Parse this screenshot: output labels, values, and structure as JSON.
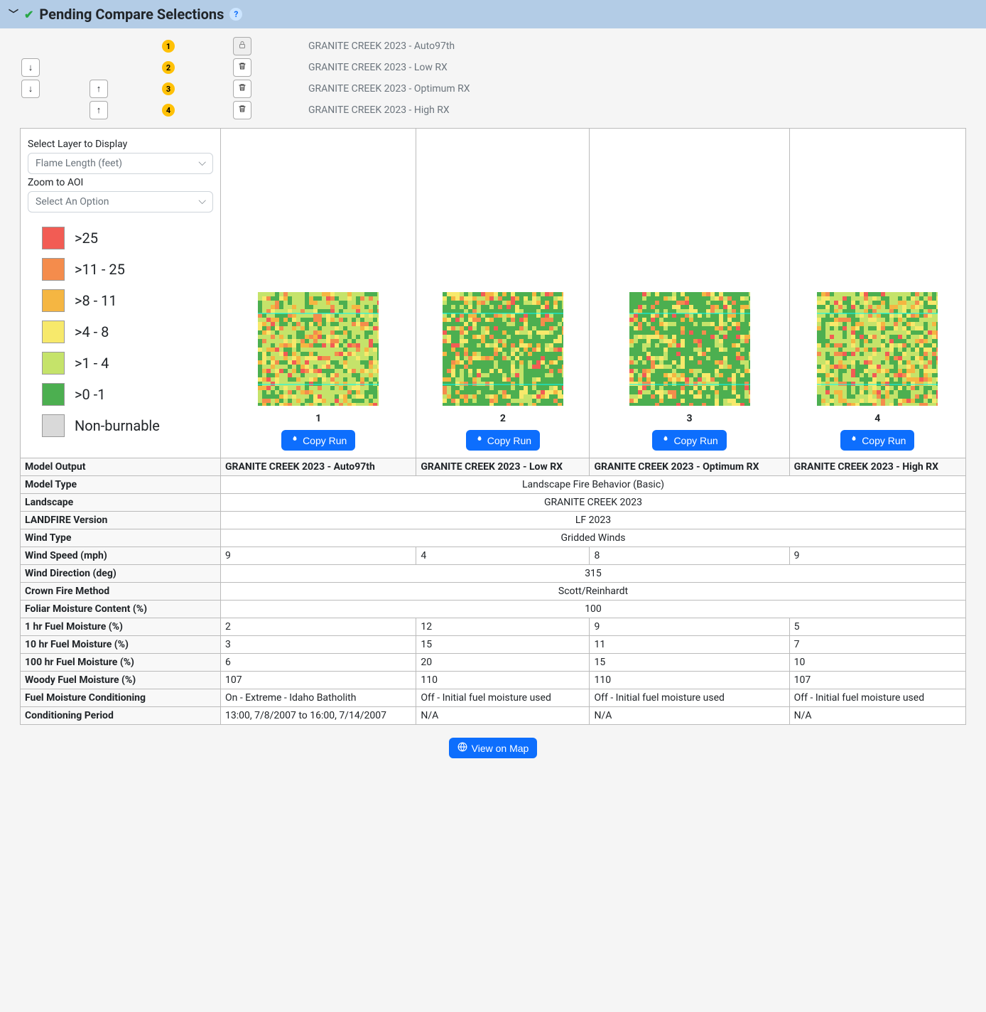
{
  "header": {
    "title": "Pending Compare Selections"
  },
  "pending": [
    {
      "badge": "1",
      "label": "GRANITE CREEK 2023 - Auto97th",
      "can_down": false,
      "can_up": false,
      "can_delete": false,
      "locked": true
    },
    {
      "badge": "2",
      "label": "GRANITE CREEK 2023 - Low RX",
      "can_down": true,
      "can_up": false,
      "can_delete": true,
      "locked": false
    },
    {
      "badge": "3",
      "label": "GRANITE CREEK 2023 - Optimum RX",
      "can_down": true,
      "can_up": true,
      "can_delete": true,
      "locked": false
    },
    {
      "badge": "4",
      "label": "GRANITE CREEK 2023 - High RX",
      "can_down": false,
      "can_up": true,
      "can_delete": true,
      "locked": false
    }
  ],
  "controls": {
    "layer_label": "Select Layer to Display",
    "layer_value": "Flame Length (feet)",
    "zoom_label": "Zoom to AOI",
    "zoom_value": "Select An Option"
  },
  "legend": [
    {
      "color": "#f25c54",
      "label": ">25"
    },
    {
      "color": "#f48c4c",
      "label": ">11 - 25"
    },
    {
      "color": "#f5b642",
      "label": ">8 - 11"
    },
    {
      "color": "#f7e96b",
      "label": ">4 - 8"
    },
    {
      "color": "#c5e36a",
      "label": ">1 - 4"
    },
    {
      "color": "#4caf50",
      "label": ">0 -1"
    },
    {
      "color": "#d9d9d9",
      "label": "Non-burnable"
    }
  ],
  "columns": [
    {
      "num": "1",
      "title": "GRANITE CREEK 2023 - Auto97th",
      "seed": 11
    },
    {
      "num": "2",
      "title": "GRANITE CREEK 2023 - Low RX",
      "seed": 22
    },
    {
      "num": "3",
      "title": "GRANITE CREEK 2023 - Optimum RX",
      "seed": 33
    },
    {
      "num": "4",
      "title": "GRANITE CREEK 2023 - High RX",
      "seed": 44
    }
  ],
  "copy_run_label": "Copy Run",
  "view_on_map_label": "View on Map",
  "rows": [
    {
      "label": "Model Output",
      "type": "header_titles"
    },
    {
      "label": "Model Type",
      "span": "Landscape Fire Behavior (Basic)"
    },
    {
      "label": "Landscape",
      "span": "GRANITE CREEK 2023"
    },
    {
      "label": "LANDFIRE Version",
      "span": "LF 2023"
    },
    {
      "label": "Wind Type",
      "span": "Gridded Winds"
    },
    {
      "label": "Wind Speed (mph)",
      "cells": [
        "9",
        "4",
        "8",
        "9"
      ]
    },
    {
      "label": "Wind Direction (deg)",
      "span": "315"
    },
    {
      "label": "Crown Fire Method",
      "span": "Scott/Reinhardt"
    },
    {
      "label": "Foliar Moisture Content (%)",
      "span": "100"
    },
    {
      "label": "1 hr Fuel Moisture (%)",
      "cells": [
        "2",
        "12",
        "9",
        "5"
      ]
    },
    {
      "label": "10 hr Fuel Moisture (%)",
      "cells": [
        "3",
        "15",
        "11",
        "7"
      ]
    },
    {
      "label": "100 hr Fuel Moisture (%)",
      "cells": [
        "6",
        "20",
        "15",
        "10"
      ]
    },
    {
      "label": "Woody Fuel Moisture (%)",
      "cells": [
        "107",
        "110",
        "110",
        "107"
      ]
    },
    {
      "label": "Fuel Moisture Conditioning",
      "cells": [
        "On - Extreme - Idaho Batholith",
        "Off - Initial fuel moisture used",
        "Off - Initial fuel moisture used",
        "Off - Initial fuel moisture used"
      ]
    },
    {
      "label": "Conditioning Period",
      "cells": [
        "13:00, 7/8/2007 to 16:00, 7/14/2007",
        "N/A",
        "N/A",
        "N/A"
      ]
    }
  ],
  "chart_data": {
    "type": "table",
    "title": "Comparison of model run inputs across four GRANITE CREEK 2023 scenarios, with Flame Length (feet) map thumbnails",
    "columns": [
      "Auto97th",
      "Low RX",
      "Optimum RX",
      "High RX"
    ],
    "legend_classes": [
      ">25",
      ">11 - 25",
      ">8 - 11",
      ">4 - 8",
      ">1 - 4",
      ">0 -1",
      "Non-burnable"
    ],
    "parameters": {
      "Model Type": [
        "Landscape Fire Behavior (Basic)",
        "Landscape Fire Behavior (Basic)",
        "Landscape Fire Behavior (Basic)",
        "Landscape Fire Behavior (Basic)"
      ],
      "Landscape": [
        "GRANITE CREEK 2023",
        "GRANITE CREEK 2023",
        "GRANITE CREEK 2023",
        "GRANITE CREEK 2023"
      ],
      "LANDFIRE Version": [
        "LF 2023",
        "LF 2023",
        "LF 2023",
        "LF 2023"
      ],
      "Wind Type": [
        "Gridded Winds",
        "Gridded Winds",
        "Gridded Winds",
        "Gridded Winds"
      ],
      "Wind Speed (mph)": [
        9,
        4,
        8,
        9
      ],
      "Wind Direction (deg)": [
        315,
        315,
        315,
        315
      ],
      "Crown Fire Method": [
        "Scott/Reinhardt",
        "Scott/Reinhardt",
        "Scott/Reinhardt",
        "Scott/Reinhardt"
      ],
      "Foliar Moisture Content (%)": [
        100,
        100,
        100,
        100
      ],
      "1 hr Fuel Moisture (%)": [
        2,
        12,
        9,
        5
      ],
      "10 hr Fuel Moisture (%)": [
        3,
        15,
        11,
        7
      ],
      "100 hr Fuel Moisture (%)": [
        6,
        20,
        15,
        10
      ],
      "Woody Fuel Moisture (%)": [
        107,
        110,
        110,
        107
      ],
      "Fuel Moisture Conditioning": [
        "On - Extreme - Idaho Batholith",
        "Off - Initial fuel moisture used",
        "Off - Initial fuel moisture used",
        "Off - Initial fuel moisture used"
      ],
      "Conditioning Period": [
        "13:00, 7/8/2007 to 16:00, 7/14/2007",
        "N/A",
        "N/A",
        "N/A"
      ]
    }
  }
}
